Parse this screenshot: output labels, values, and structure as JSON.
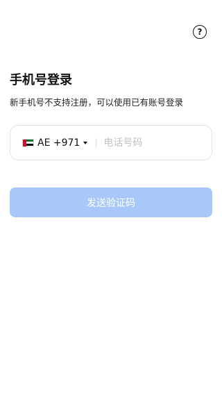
{
  "header": {
    "help_icon_glyph": "?",
    "help_icon": "question-circle-icon"
  },
  "login": {
    "title": "手机号登录",
    "subtitle": "新手机号不支持注册，可以使用已有账号登录"
  },
  "phone": {
    "country_code": "AE +971",
    "country_flag": "ae-flag-icon",
    "placeholder": "电话号码",
    "value": ""
  },
  "actions": {
    "send_code_label": "发送验证码",
    "send_code_color": "#a9c8fa"
  }
}
